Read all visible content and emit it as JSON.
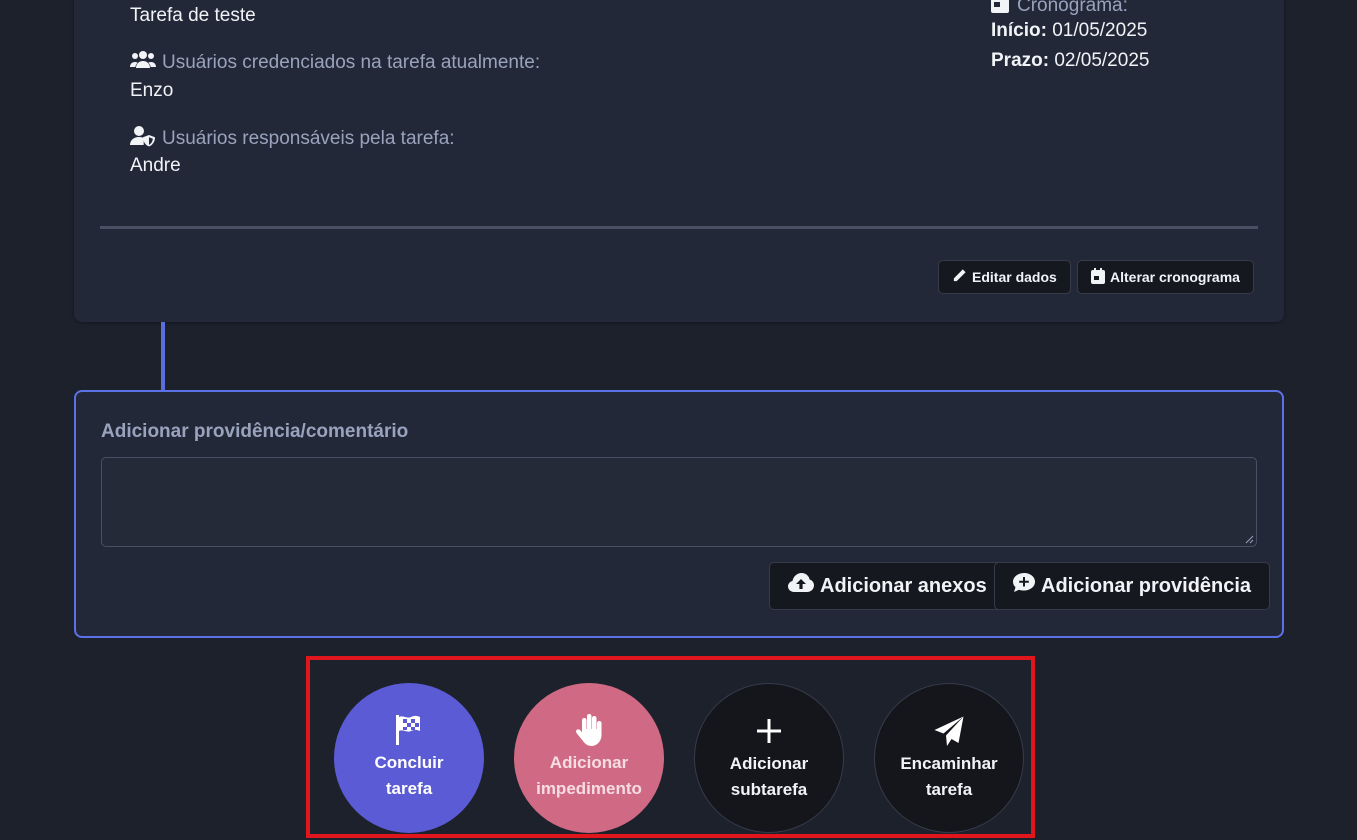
{
  "task": {
    "title": "Tarefa de teste",
    "credentialed_label": "Usuários credenciados na tarefa atualmente:",
    "credentialed_value": "Enzo",
    "responsible_label": "Usuários responsáveis pela tarefa:",
    "responsible_value": "Andre"
  },
  "schedule": {
    "label": "Cronograma:",
    "start_label": "Início:",
    "start_value": "01/05/2025",
    "deadline_label": "Prazo:",
    "deadline_value": "02/05/2025"
  },
  "card_actions": {
    "edit_label": "Editar dados",
    "schedule_label": "Alterar cronograma"
  },
  "comment": {
    "label": "Adicionar providência/comentário",
    "value": "",
    "attach_label": "Adicionar anexos",
    "submit_label": "Adicionar providência"
  },
  "actions": [
    {
      "line1": "Concluir",
      "line2": "tarefa",
      "icon": "checkered-flag-icon",
      "color": "#5b5bd6"
    },
    {
      "line1": "Adicionar",
      "line2": "impedimento",
      "icon": "hand-icon",
      "color": "#d06a84"
    },
    {
      "line1": "Adicionar",
      "line2": "subtarefa",
      "icon": "plus-icon",
      "color": "#15161b"
    },
    {
      "line1": "Encaminhar",
      "line2": "tarefa",
      "icon": "paper-plane-icon",
      "color": "#15161b"
    }
  ],
  "colors": {
    "accent": "#5b72e6",
    "highlight": "#e0161c",
    "background": "#1d212c",
    "card": "#232838"
  }
}
